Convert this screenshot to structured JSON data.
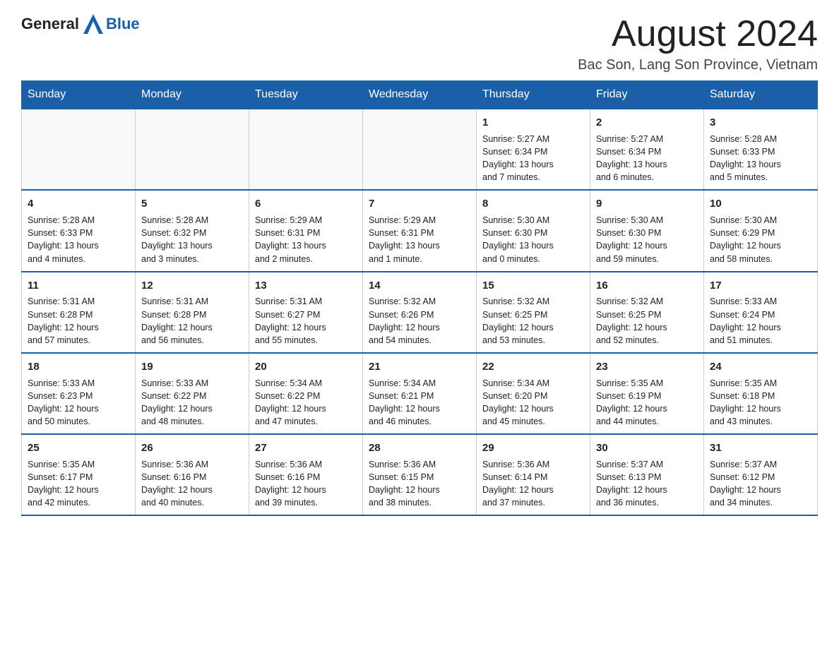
{
  "header": {
    "logo_general": "General",
    "logo_blue": "Blue",
    "month_year": "August 2024",
    "location": "Bac Son, Lang Son Province, Vietnam"
  },
  "weekdays": [
    "Sunday",
    "Monday",
    "Tuesday",
    "Wednesday",
    "Thursday",
    "Friday",
    "Saturday"
  ],
  "weeks": [
    [
      {
        "day": "",
        "info": ""
      },
      {
        "day": "",
        "info": ""
      },
      {
        "day": "",
        "info": ""
      },
      {
        "day": "",
        "info": ""
      },
      {
        "day": "1",
        "info": "Sunrise: 5:27 AM\nSunset: 6:34 PM\nDaylight: 13 hours\nand 7 minutes."
      },
      {
        "day": "2",
        "info": "Sunrise: 5:27 AM\nSunset: 6:34 PM\nDaylight: 13 hours\nand 6 minutes."
      },
      {
        "day": "3",
        "info": "Sunrise: 5:28 AM\nSunset: 6:33 PM\nDaylight: 13 hours\nand 5 minutes."
      }
    ],
    [
      {
        "day": "4",
        "info": "Sunrise: 5:28 AM\nSunset: 6:33 PM\nDaylight: 13 hours\nand 4 minutes."
      },
      {
        "day": "5",
        "info": "Sunrise: 5:28 AM\nSunset: 6:32 PM\nDaylight: 13 hours\nand 3 minutes."
      },
      {
        "day": "6",
        "info": "Sunrise: 5:29 AM\nSunset: 6:31 PM\nDaylight: 13 hours\nand 2 minutes."
      },
      {
        "day": "7",
        "info": "Sunrise: 5:29 AM\nSunset: 6:31 PM\nDaylight: 13 hours\nand 1 minute."
      },
      {
        "day": "8",
        "info": "Sunrise: 5:30 AM\nSunset: 6:30 PM\nDaylight: 13 hours\nand 0 minutes."
      },
      {
        "day": "9",
        "info": "Sunrise: 5:30 AM\nSunset: 6:30 PM\nDaylight: 12 hours\nand 59 minutes."
      },
      {
        "day": "10",
        "info": "Sunrise: 5:30 AM\nSunset: 6:29 PM\nDaylight: 12 hours\nand 58 minutes."
      }
    ],
    [
      {
        "day": "11",
        "info": "Sunrise: 5:31 AM\nSunset: 6:28 PM\nDaylight: 12 hours\nand 57 minutes."
      },
      {
        "day": "12",
        "info": "Sunrise: 5:31 AM\nSunset: 6:28 PM\nDaylight: 12 hours\nand 56 minutes."
      },
      {
        "day": "13",
        "info": "Sunrise: 5:31 AM\nSunset: 6:27 PM\nDaylight: 12 hours\nand 55 minutes."
      },
      {
        "day": "14",
        "info": "Sunrise: 5:32 AM\nSunset: 6:26 PM\nDaylight: 12 hours\nand 54 minutes."
      },
      {
        "day": "15",
        "info": "Sunrise: 5:32 AM\nSunset: 6:25 PM\nDaylight: 12 hours\nand 53 minutes."
      },
      {
        "day": "16",
        "info": "Sunrise: 5:32 AM\nSunset: 6:25 PM\nDaylight: 12 hours\nand 52 minutes."
      },
      {
        "day": "17",
        "info": "Sunrise: 5:33 AM\nSunset: 6:24 PM\nDaylight: 12 hours\nand 51 minutes."
      }
    ],
    [
      {
        "day": "18",
        "info": "Sunrise: 5:33 AM\nSunset: 6:23 PM\nDaylight: 12 hours\nand 50 minutes."
      },
      {
        "day": "19",
        "info": "Sunrise: 5:33 AM\nSunset: 6:22 PM\nDaylight: 12 hours\nand 48 minutes."
      },
      {
        "day": "20",
        "info": "Sunrise: 5:34 AM\nSunset: 6:22 PM\nDaylight: 12 hours\nand 47 minutes."
      },
      {
        "day": "21",
        "info": "Sunrise: 5:34 AM\nSunset: 6:21 PM\nDaylight: 12 hours\nand 46 minutes."
      },
      {
        "day": "22",
        "info": "Sunrise: 5:34 AM\nSunset: 6:20 PM\nDaylight: 12 hours\nand 45 minutes."
      },
      {
        "day": "23",
        "info": "Sunrise: 5:35 AM\nSunset: 6:19 PM\nDaylight: 12 hours\nand 44 minutes."
      },
      {
        "day": "24",
        "info": "Sunrise: 5:35 AM\nSunset: 6:18 PM\nDaylight: 12 hours\nand 43 minutes."
      }
    ],
    [
      {
        "day": "25",
        "info": "Sunrise: 5:35 AM\nSunset: 6:17 PM\nDaylight: 12 hours\nand 42 minutes."
      },
      {
        "day": "26",
        "info": "Sunrise: 5:36 AM\nSunset: 6:16 PM\nDaylight: 12 hours\nand 40 minutes."
      },
      {
        "day": "27",
        "info": "Sunrise: 5:36 AM\nSunset: 6:16 PM\nDaylight: 12 hours\nand 39 minutes."
      },
      {
        "day": "28",
        "info": "Sunrise: 5:36 AM\nSunset: 6:15 PM\nDaylight: 12 hours\nand 38 minutes."
      },
      {
        "day": "29",
        "info": "Sunrise: 5:36 AM\nSunset: 6:14 PM\nDaylight: 12 hours\nand 37 minutes."
      },
      {
        "day": "30",
        "info": "Sunrise: 5:37 AM\nSunset: 6:13 PM\nDaylight: 12 hours\nand 36 minutes."
      },
      {
        "day": "31",
        "info": "Sunrise: 5:37 AM\nSunset: 6:12 PM\nDaylight: 12 hours\nand 34 minutes."
      }
    ]
  ]
}
